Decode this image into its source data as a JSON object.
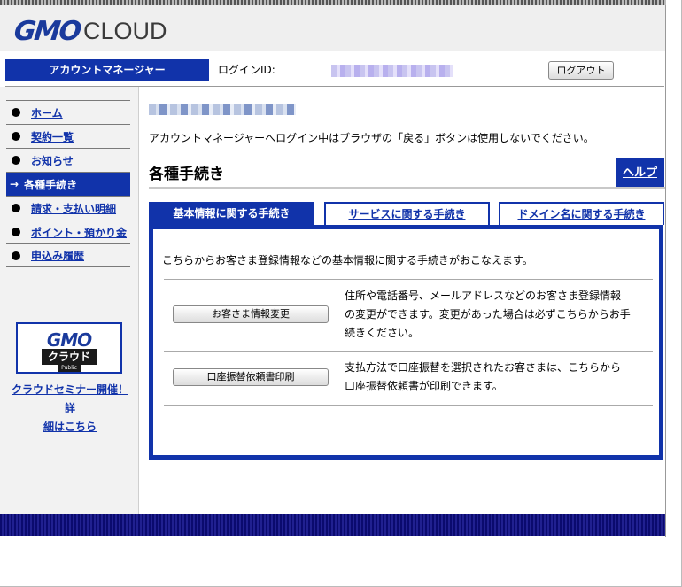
{
  "header": {
    "logo_gmo": "GMO",
    "logo_cloud": "CLOUD"
  },
  "topbar": {
    "title": "アカウントマネージャー",
    "login_label": "ログインID:",
    "logout_label": "ログアウト"
  },
  "sidebar": {
    "items": [
      {
        "label": "ホーム",
        "active": false
      },
      {
        "label": "契約一覧",
        "active": false
      },
      {
        "label": "お知らせ",
        "active": false
      },
      {
        "label": "各種手続き",
        "active": true
      },
      {
        "label": "請求・支払い明細",
        "active": false
      },
      {
        "label": "ポイント・預かり金",
        "active": false
      },
      {
        "label": "申込み履歴",
        "active": false
      }
    ],
    "active_arrow": "→",
    "banner": {
      "logo": "GMO",
      "name": "クラウド",
      "sub": "Public"
    },
    "seminar_line1": "クラウドセミナー開催！詳",
    "seminar_line2": "細はこちら"
  },
  "main": {
    "notice": "アカウントマネージャーへログイン中はブラウザの「戻る」ボタンは使用しないでください。",
    "title": "各種手続き",
    "help": "ヘルプ",
    "tabs": [
      {
        "label": "基本情報に関する手続き",
        "active": true
      },
      {
        "label": "サービスに関する手続き",
        "active": false
      },
      {
        "label": "ドメイン名に関する手続き",
        "active": false
      }
    ],
    "panel": {
      "intro": "こちらからお客さま登録情報などの基本情報に関する手続きがおこなえます。",
      "rows": [
        {
          "button": "お客さま情報変更",
          "desc_lines": [
            "住所や電話番号、メールアドレスなどのお客さま登録情報",
            "の変更ができます。変更があった場合は必ずこちらからお手",
            "続きください。"
          ]
        },
        {
          "button": "口座振替依頼書印刷",
          "desc_lines": [
            "支払方法で口座振替を選択されたお客さまは、こちらから",
            "口座振替依頼書が印刷できます。"
          ]
        }
      ]
    }
  }
}
